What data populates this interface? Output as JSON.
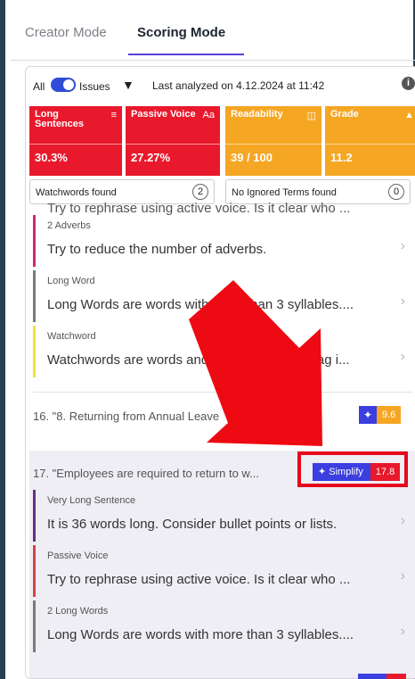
{
  "tabs": [
    {
      "label": "Creator Mode",
      "active": false
    },
    {
      "label": "Scoring Mode",
      "active": true
    }
  ],
  "toolbar": {
    "all_label": "All",
    "issues_label": "Issues",
    "last_analyzed": "Last analyzed on 4.12.2024 at 11:42",
    "filter_icon": "filter-icon",
    "info_icon": "info-icon"
  },
  "metrics": [
    {
      "label": "Long Sentences",
      "value": "30.3%",
      "icon": "paragraph-icon",
      "color": "#e8192c"
    },
    {
      "label": "Passive Voice",
      "value": "27.27%",
      "icon": "font-icon",
      "color": "#e8192c"
    },
    {
      "label": "Readability",
      "value": "39 / 100",
      "icon": "book-icon",
      "color": "#f5a623"
    },
    {
      "label": "Grade",
      "value": "11.2",
      "icon": "graduation-icon",
      "color": "#f5a623"
    }
  ],
  "found": [
    {
      "label": "Watchwords found",
      "count": "2"
    },
    {
      "label": "No Ignored Terms found",
      "count": "0"
    }
  ],
  "cutoff_text": "Try to rephrase using active voice. Is it clear who ...",
  "upper_items": [
    {
      "type": "2 Adverbs",
      "message": "Try to reduce the number of adverbs.",
      "color": "#d6257d"
    },
    {
      "type": "Long Word",
      "message": "Long Words are words with more than 3 syllables....",
      "color": "#7a7a7a"
    },
    {
      "type": "Watchword",
      "message": "Watchwords are words and phrases that we flag i...",
      "color": "#f2e23a"
    }
  ],
  "section16": {
    "title": "16. \"8. Returning from Annual Leave",
    "score": "9.6"
  },
  "section17": {
    "title": "17. \"Employees are required to return to w...",
    "simplify_label": "Simplify",
    "score": "17.8"
  },
  "lower_items": [
    {
      "type": "Very Long Sentence",
      "message": "It is 36 words long. Consider bullet points or lists.",
      "color": "#6a2c8c"
    },
    {
      "type": "Passive Voice",
      "message": "Try to rephrase using active voice. Is it clear who ...",
      "color": "#d64545"
    },
    {
      "type": "2 Long Words",
      "message": "Long Words are words with more than 3 syllables....",
      "color": "#7a7a7a"
    }
  ],
  "accent": "#5b3fd6",
  "sparkle_icon": "sparkle-icon",
  "chevron_icon": "chevron-right-icon"
}
